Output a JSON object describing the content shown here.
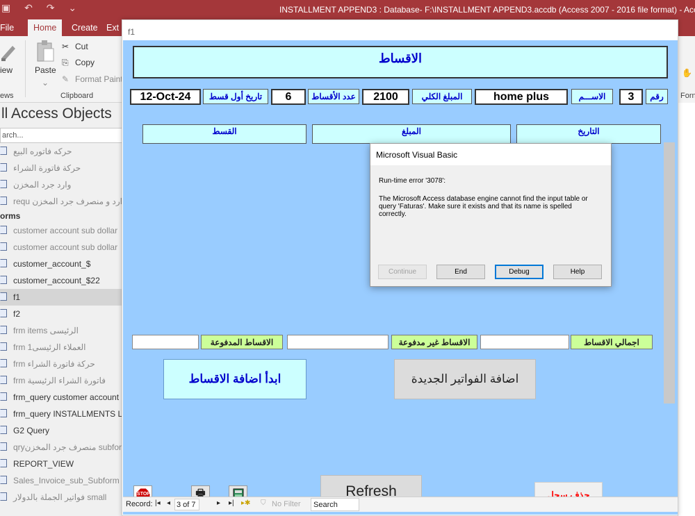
{
  "app": {
    "title": "INSTALLMENT APPEND3 : Database- F:\\INSTALLMENT APPEND3.accdb (Access 2007 - 2016 file format)  -  Acce",
    "tabs": [
      "File",
      "Home",
      "Create",
      "Ext"
    ],
    "active_tab": "Home"
  },
  "ribbon": {
    "view_label": "iew",
    "views_group": "ews",
    "paste_label": "Paste",
    "cut_label": "Cut",
    "copy_label": "Copy",
    "format_painter_label": "Format Paint",
    "clipboard_group": "Clipboard",
    "right_group_fragment": "Forn"
  },
  "nav": {
    "title": "ll Access Objects",
    "search_placeholder": "arch...",
    "items_top": [
      "حركه فاتوره البيع",
      "حركة فاتورة الشراء",
      "وارد جرد المخزن",
      "وارد و منصرف جرد المخزن  requ"
    ],
    "forms_header": "orms",
    "forms": [
      "customer account sub dollar",
      "customer account sub dollar",
      "customer_account_$",
      "customer_account_$22",
      "f1",
      "f2",
      "frm items الرئيسى",
      "frm 1العملاء الرئيسى",
      "frm حركة فاتورة الشراء",
      "frm فاتورة الشراء الرئيسية",
      "frm_query customer account",
      "frm_query INSTALLMENTS Lis",
      "G2 Query",
      "qryمنصرف جرد المخزن subfor",
      "REPORT_VIEW",
      "Sales_Invoice_sub_Subform",
      "small فواتير الجملة بالدولار"
    ],
    "selected": "f1"
  },
  "form": {
    "window_title": "f1",
    "header_title": "الاقساط",
    "fields": {
      "number_label": "رقم",
      "number_value": "3",
      "name_label": "الاســـم",
      "name_value": "home plus",
      "total_label": "المبلغ الكلي",
      "total_value": "2100",
      "count_label": "عدد الأقساط",
      "count_value": "6",
      "first_date_label": "تاريخ أول قسط",
      "first_date_value": "12-Oct-24"
    },
    "columns": {
      "date": "التاريخ",
      "amount": "المبلغ",
      "installment": "القسط"
    },
    "totals": {
      "total_label": "اجمالي الاقساط",
      "unpaid_label": "الاقساط غير مدفوعة",
      "paid_label": "الاقساط  المدفوعة"
    },
    "buttons": {
      "start_installments": "ابدأ اضافة الاقساط",
      "add_invoices": "اضافة الفواتير الجديدة",
      "refresh": "Refresh",
      "delete_record": "حذف سجل",
      "stop": "STOP"
    },
    "record_nav": {
      "record_label": "Record:",
      "position": "3 of 7",
      "filter_label": "No Filter",
      "search_label": "Search"
    }
  },
  "dialog": {
    "title": "Microsoft Visual Basic",
    "error_line": "Run-time error '3078':",
    "message": "The Microsoft Access database engine cannot find the input table or query 'Faturas'. Make sure it exists and that its name is spelled correctly.",
    "buttons": [
      "Continue",
      "End",
      "Debug",
      "Help"
    ]
  },
  "colors": {
    "access_accent": "#a4373a",
    "form_background": "#99ccff",
    "label_cyan": "#ccffff",
    "label_green": "#ccff99",
    "delete_text": "#ff0000",
    "stop_red": "#cc0000"
  }
}
